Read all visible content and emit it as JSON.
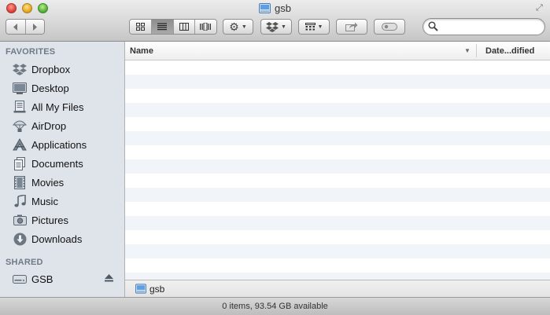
{
  "window": {
    "title": "gsb",
    "title_icon": "drive-icon"
  },
  "toolbar": {
    "view_buttons": [
      {
        "name": "icon-view",
        "icon": "icon-view-icon",
        "active": false
      },
      {
        "name": "list-view",
        "icon": "list-view-icon",
        "active": true
      },
      {
        "name": "column-view",
        "icon": "column-view-icon",
        "active": false
      },
      {
        "name": "cover-flow-view",
        "icon": "cover-flow-icon",
        "active": false
      }
    ],
    "action_icon": "gear-icon",
    "dropbox_icon": "dropbox-icon",
    "arrange_icon": "arrange-icon",
    "share_icon": "share-icon",
    "tag_icon": "tag-icon",
    "search": {
      "value": "",
      "placeholder": ""
    }
  },
  "sidebar": {
    "favorites_header": "FAVORITES",
    "favorites": [
      {
        "label": "Dropbox",
        "icon": "dropbox-icon"
      },
      {
        "label": "Desktop",
        "icon": "desktop-icon"
      },
      {
        "label": "All My Files",
        "icon": "all-files-icon"
      },
      {
        "label": "AirDrop",
        "icon": "airdrop-icon"
      },
      {
        "label": "Applications",
        "icon": "applications-icon"
      },
      {
        "label": "Documents",
        "icon": "documents-icon"
      },
      {
        "label": "Movies",
        "icon": "movies-icon"
      },
      {
        "label": "Music",
        "icon": "music-icon"
      },
      {
        "label": "Pictures",
        "icon": "pictures-icon"
      },
      {
        "label": "Downloads",
        "icon": "downloads-icon"
      }
    ],
    "shared_header": "SHARED",
    "shared": [
      {
        "label": "GSB",
        "icon": "network-drive-icon",
        "eject": true
      }
    ]
  },
  "list": {
    "columns": [
      "Name",
      "Date...dified"
    ],
    "rows": []
  },
  "pathbar": {
    "label": "gsb",
    "icon": "drive-icon"
  },
  "status": {
    "text": "0 items, 93.54 GB available"
  },
  "colors": {
    "sidebar_bg": "#dfe4ea",
    "sidebar_header": "#6e7a87",
    "row_alt": "#f1f5fa"
  }
}
